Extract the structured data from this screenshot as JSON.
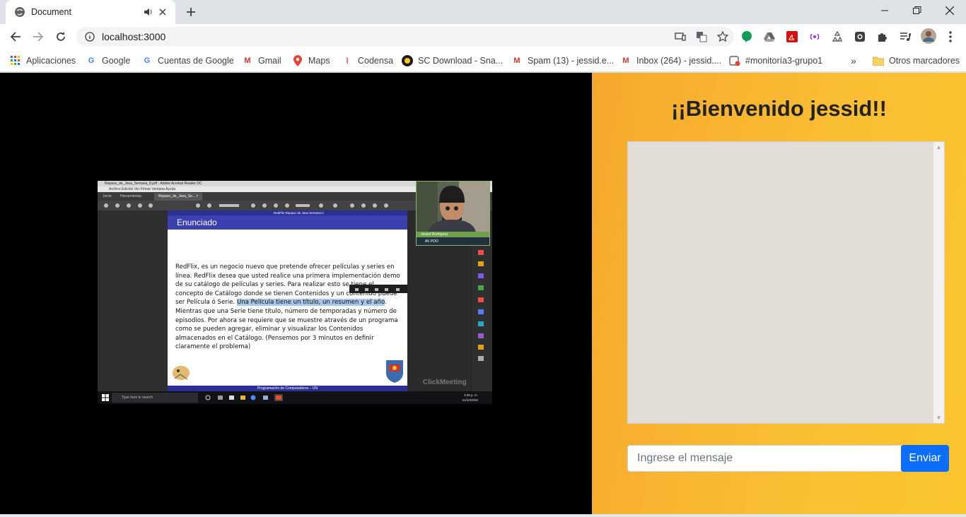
{
  "browser": {
    "tab_title": "Document",
    "url": "localhost:3000",
    "bookmarks": [
      {
        "label": "Aplicaciones",
        "icon": "apps-grid-icon"
      },
      {
        "label": "Google",
        "icon": "google-icon"
      },
      {
        "label": "Cuentas de Google",
        "icon": "google-icon"
      },
      {
        "label": "Gmail",
        "icon": "gmail-icon"
      },
      {
        "label": "Maps",
        "icon": "maps-pin-icon"
      },
      {
        "label": "Codensa",
        "icon": "codensa-icon"
      },
      {
        "label": "SC Download - Sna...",
        "icon": "sc-download-icon"
      },
      {
        "label": "Spam (13) - jessid.e...",
        "icon": "gmail-icon"
      },
      {
        "label": "Inbox (264) - jessid....",
        "icon": "gmail-icon"
      },
      {
        "label": "#monitoría3-grupo1",
        "icon": "slack-icon"
      }
    ],
    "bookmarks_more": "»",
    "other_bookmarks": "Otros marcadores"
  },
  "app": {
    "welcome": "¡¡Bienvenido jessid!!",
    "message_placeholder": "Ingrese el mensaje",
    "send_label": "Enviar"
  },
  "screen_share": {
    "window_title": "Repaso_de_Java_Semana_8.pdf - Adobe Acrobat Reader DC",
    "menu": "Archivo  Edición  Ver  Firmar  Ventana  Ayuda",
    "tabs": [
      "Inicio",
      "Herramientas",
      "Repaso_de_Java_Se... ×"
    ],
    "slide_top": "RedFlix     Repaso de Java Semana II",
    "slide_heading": "Enunciado",
    "slide_text_before": "RedFlix, es un negocio nuevo que pretende ofrecer películas y series en línea. RedFlix desea que usted realice una primera implementación demo de su catálogo de películas y series. Para realizar esto se tiene el concepto de Catálogo donde se tienen Contenidos y un contenido puede ser Película ó Serie. ",
    "slide_text_highlight": "Una Película tiene un título, un resumen y el año",
    "slide_text_after": ". Mientras que una Serie tiene título, número de temporadas y número de episodios. Por ahora se requiere que se muestre através de un programa como se pueden agregar, eliminar y visualizar los Contenidos almacenados en el Catálogo. (Pensemos por 3 minutos en definir claramente el problema)",
    "slide_footer": "Programación de Computadores – UN",
    "cam_name": "Jessid Rodríguez",
    "cam_label": "AV POO",
    "taskbar_search": "Type here to search",
    "taskbar_time": "3:39 p. m.",
    "taskbar_date": "21/10/2020",
    "watermark": "ClickMeeting"
  },
  "colors": {
    "panel_gradient_start": "#f6a82c",
    "panel_gradient_end": "#fbc52f",
    "send_button": "#0d6efd",
    "chat_bg": "#e3ddd8"
  }
}
